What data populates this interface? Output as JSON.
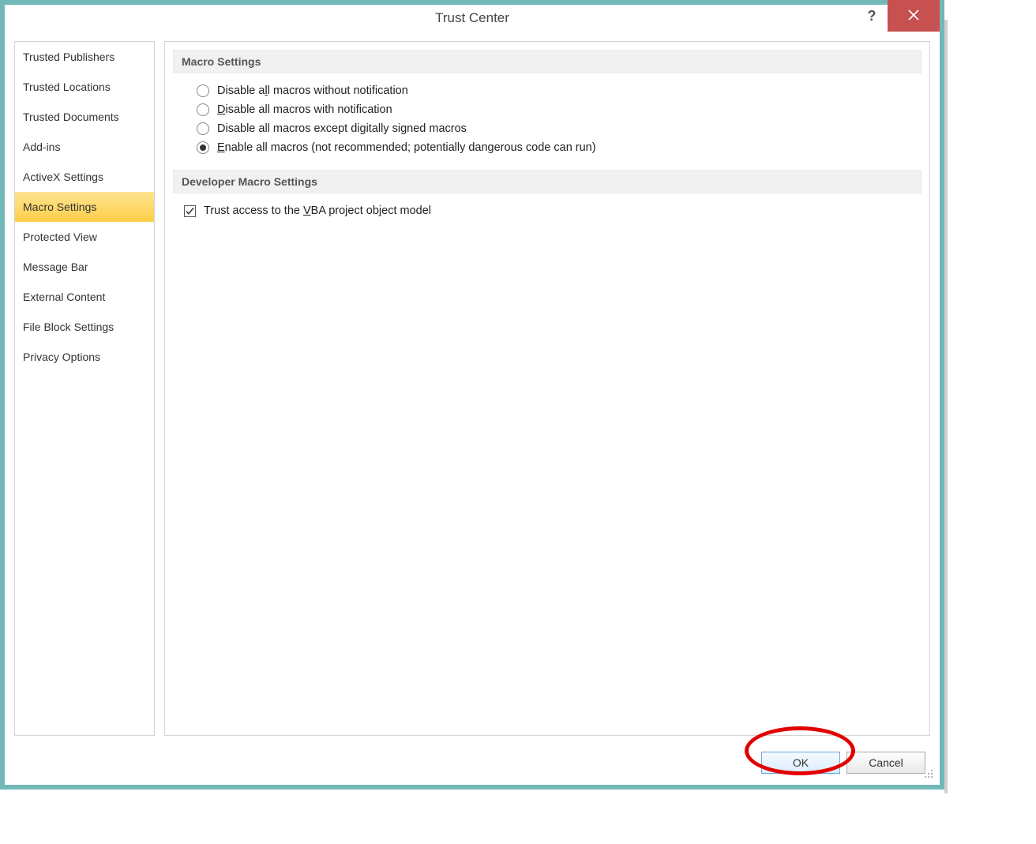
{
  "window": {
    "title": "Trust Center"
  },
  "sidebar": {
    "items": [
      {
        "label": "Trusted Publishers"
      },
      {
        "label": "Trusted Locations"
      },
      {
        "label": "Trusted Documents"
      },
      {
        "label": "Add-ins"
      },
      {
        "label": "ActiveX Settings"
      },
      {
        "label": "Macro Settings"
      },
      {
        "label": "Protected View"
      },
      {
        "label": "Message Bar"
      },
      {
        "label": "External Content"
      },
      {
        "label": "File Block Settings"
      },
      {
        "label": "Privacy Options"
      }
    ],
    "selected_index": 5
  },
  "sections": {
    "macro_settings": {
      "title": "Macro Settings",
      "options": [
        {
          "pre": "Disable a",
          "accel": "l",
          "post": "l macros without notification"
        },
        {
          "pre": "",
          "accel": "D",
          "post": "isable all macros with notification"
        },
        {
          "pre": "Disable all macros except digitally si",
          "accel": "g",
          "post": "ned macros"
        },
        {
          "pre": "",
          "accel": "E",
          "post": "nable all macros (not recommended; potentially dangerous code can run)"
        }
      ],
      "selected_index": 3
    },
    "dev_macro_settings": {
      "title": "Developer Macro Settings",
      "checkbox": {
        "pre": "Trust access to the ",
        "accel": "V",
        "post": "BA project object model",
        "checked": true
      }
    }
  },
  "buttons": {
    "ok": "OK",
    "cancel": "Cancel"
  }
}
